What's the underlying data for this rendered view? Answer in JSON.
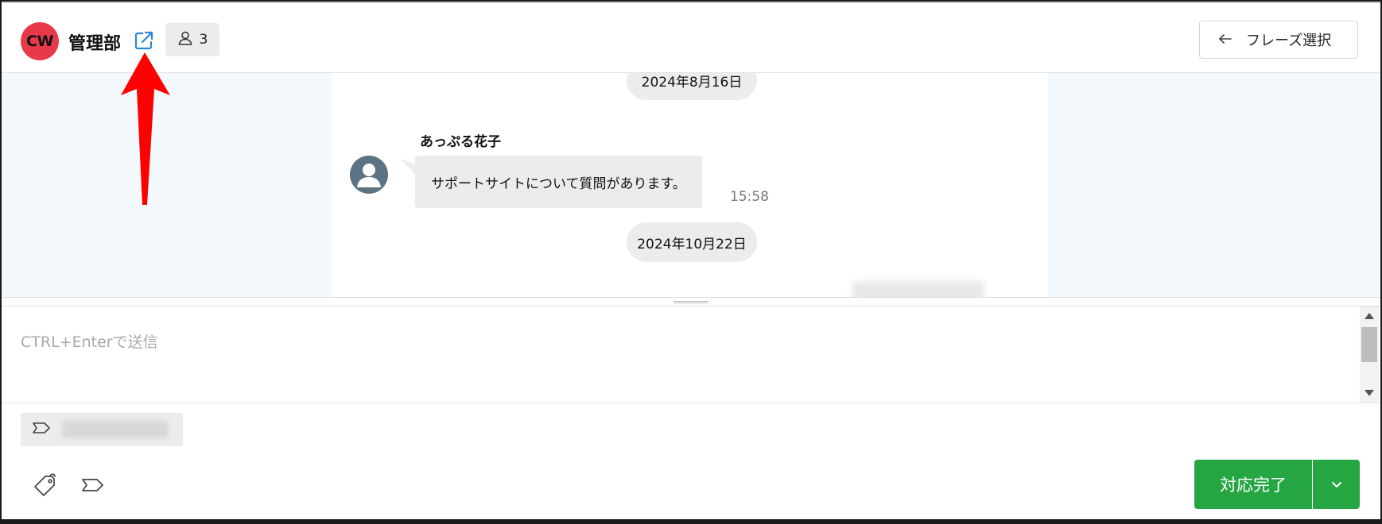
{
  "header": {
    "room_avatar_text": "CW",
    "room_avatar_color": "#e8394b",
    "room_name": "管理部",
    "external_link_icon": "external-link-icon",
    "member_count": "3",
    "phrase_select_label": "フレーズ選択"
  },
  "chat": {
    "dates": [
      "2024年8月16日",
      "2024年10月22日"
    ],
    "message": {
      "sender": "あっぷる花子",
      "text": "サポートサイトについて質問があります。",
      "time": "15:58"
    }
  },
  "input": {
    "placeholder": "CTRL+Enterで送信"
  },
  "footer": {
    "complete_label": "対応完了",
    "accent_color": "#26a643"
  },
  "annotation": {
    "arrow_color": "#ff0000"
  }
}
